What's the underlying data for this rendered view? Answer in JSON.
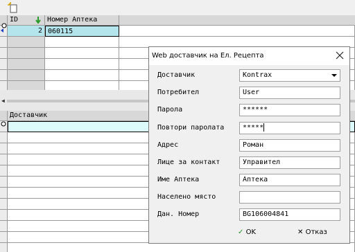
{
  "toolbar": {
    "new_record_icon": "new-record-icon"
  },
  "top_grid": {
    "columns": [
      "ID",
      "Номер Аптека"
    ],
    "rows": [
      {
        "id": "2",
        "number": "060115"
      }
    ]
  },
  "bottom_grid": {
    "columns": [
      "Доставчик"
    ]
  },
  "dialog": {
    "title": "Web доставчик на Ел. Рецепта",
    "fields": [
      {
        "label": "Доставчик",
        "value": "Kontrax"
      },
      {
        "label": "Потребител",
        "value": "User"
      },
      {
        "label": "Парола",
        "value": "******"
      },
      {
        "label": "Повтори паролата",
        "value": "*****"
      },
      {
        "label": "Адрес",
        "value": "Роман"
      },
      {
        "label": "Лице за контакт",
        "value": "Управител"
      },
      {
        "label": "Име Аптека",
        "value": "Аптека"
      },
      {
        "label": "Населено място",
        "value": ""
      },
      {
        "label": "Дан. Номер",
        "value": "BG106004841"
      }
    ],
    "ok_label": "OK",
    "cancel_label": "Отказ"
  },
  "colors": {
    "selected_cell": "#b4e4ec",
    "new_row": "#dcfafa",
    "ok_green": "#2a8a2a"
  }
}
